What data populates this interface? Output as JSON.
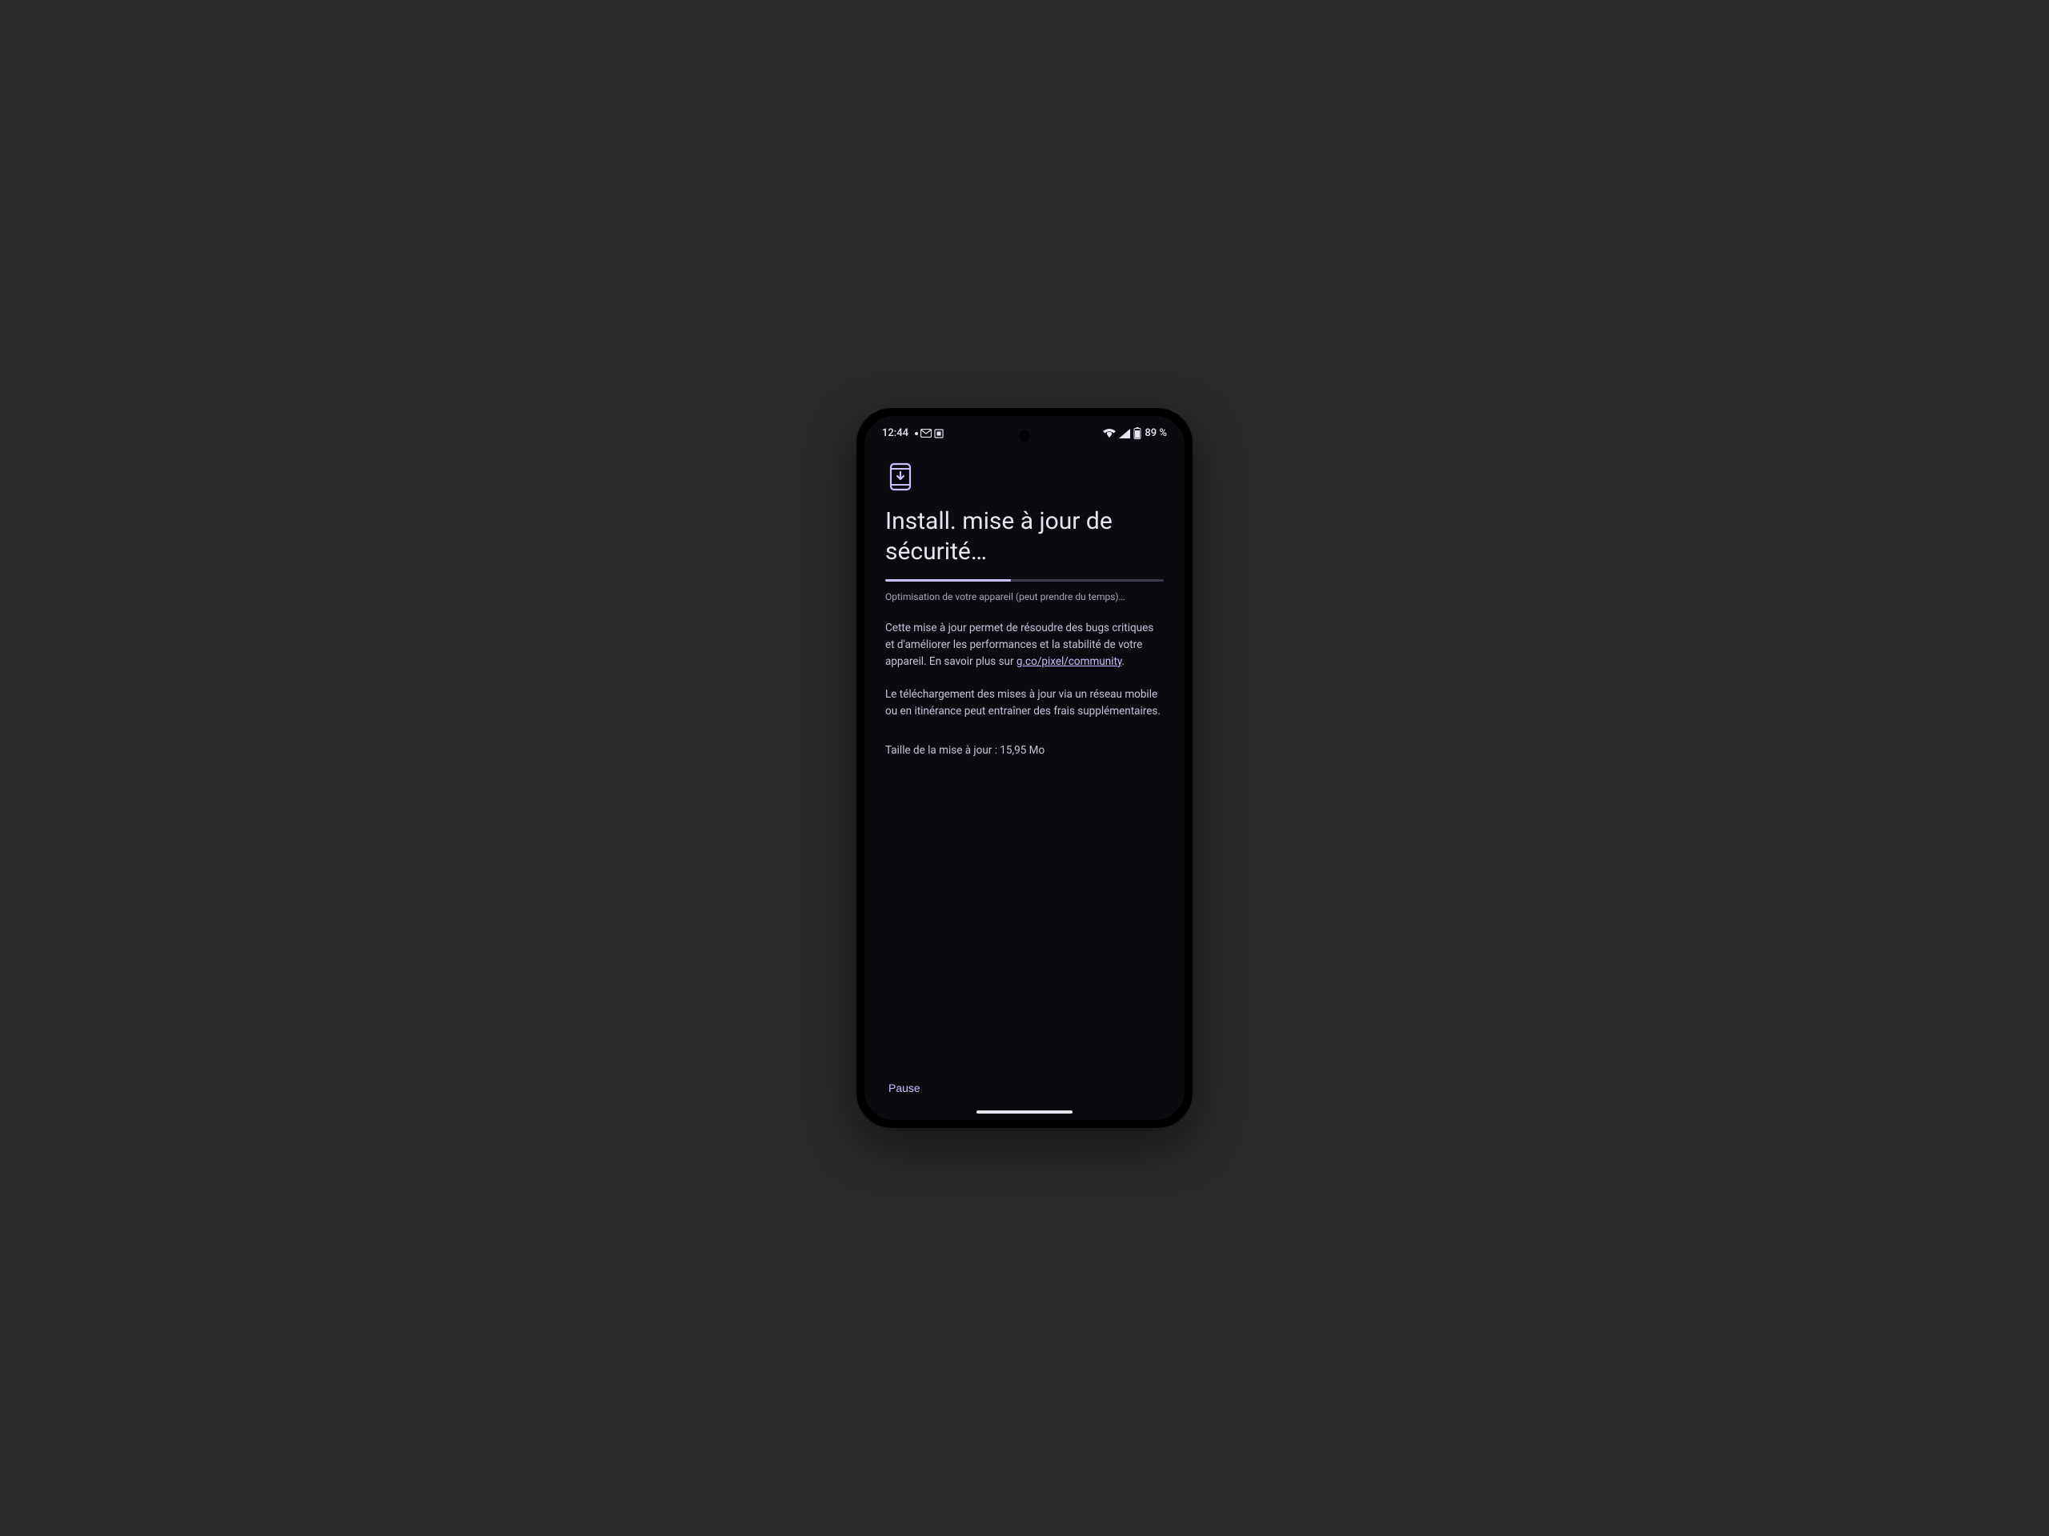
{
  "status_bar": {
    "time": "12:44",
    "battery_text": "89 %"
  },
  "page": {
    "title": "Install. mise à jour de sécurité…",
    "progress_status": "Optimisation de votre appareil (peut prendre du temps)…",
    "body_1_prefix": "Cette mise à jour permet de résoudre des bugs critiques et d'améliorer les performances et la stabilité de votre appareil. En savoir plus sur ",
    "body_1_link": "g.co/pixel/community",
    "body_1_suffix": ".",
    "body_2": "Le téléchargement des mises à jour via un réseau mobile ou en itinérance peut entraîner des frais supplémentaires.",
    "size_text": "Taille de la mise à jour : 15,95 Mo",
    "progress_percent": 45
  },
  "actions": {
    "pause_label": "Pause"
  },
  "colors": {
    "accent": "#c8bfff",
    "bg": "#0a0a0f"
  }
}
